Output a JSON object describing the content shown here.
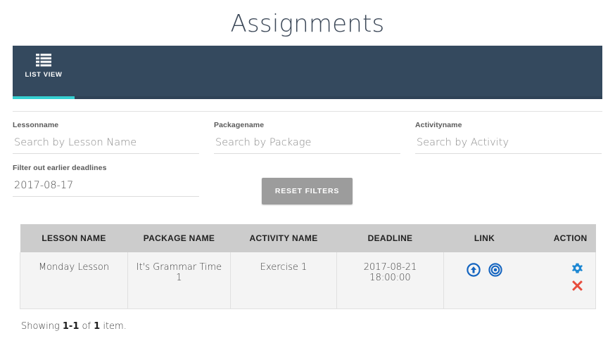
{
  "page": {
    "title": "Assignments"
  },
  "tabs": [
    {
      "label": "LIST VIEW",
      "icon": "list-view-icon",
      "active": true
    }
  ],
  "theme": {
    "header_bg": "#34495e",
    "accent_teal": "#35cfd1",
    "table_header_bg": "#cccccc",
    "row_bg": "#f4f4f4",
    "link_icon_color": "#1565c0",
    "gear_icon_color": "#1e88d3",
    "delete_icon_color": "#e74c3c",
    "reset_button_bg": "#9c9c9c"
  },
  "filters": {
    "lesson": {
      "label": "Lessonname",
      "placeholder": "Search by Lesson Name",
      "value": ""
    },
    "package": {
      "label": "Packagename",
      "placeholder": "Search by Package",
      "value": ""
    },
    "activity": {
      "label": "Activityname",
      "placeholder": "Search by Activity",
      "value": ""
    },
    "deadline": {
      "label": "Filter out earlier deadlines",
      "placeholder": "",
      "value": "2017-08-17"
    },
    "reset_label": "RESET FILTERS"
  },
  "table": {
    "columns": [
      "LESSON NAME",
      "PACKAGE NAME",
      "ACTIVITY NAME",
      "DEADLINE",
      "LINK",
      "ACTION"
    ],
    "rows": [
      {
        "lesson_name": "Monday Lesson",
        "package_name": "It's Grammar Time 1",
        "activity_name": "Exercise 1",
        "deadline": "2017-08-21 18:00:00",
        "link_icons": [
          "arrow-up-circle-icon",
          "bullseye-target-icon"
        ],
        "action_icons": [
          "gear-icon",
          "close-x-icon"
        ]
      }
    ]
  },
  "footer": {
    "showing_prefix": "Showing ",
    "range": "1-1",
    "of": " of ",
    "total": "1",
    "suffix": " item."
  }
}
